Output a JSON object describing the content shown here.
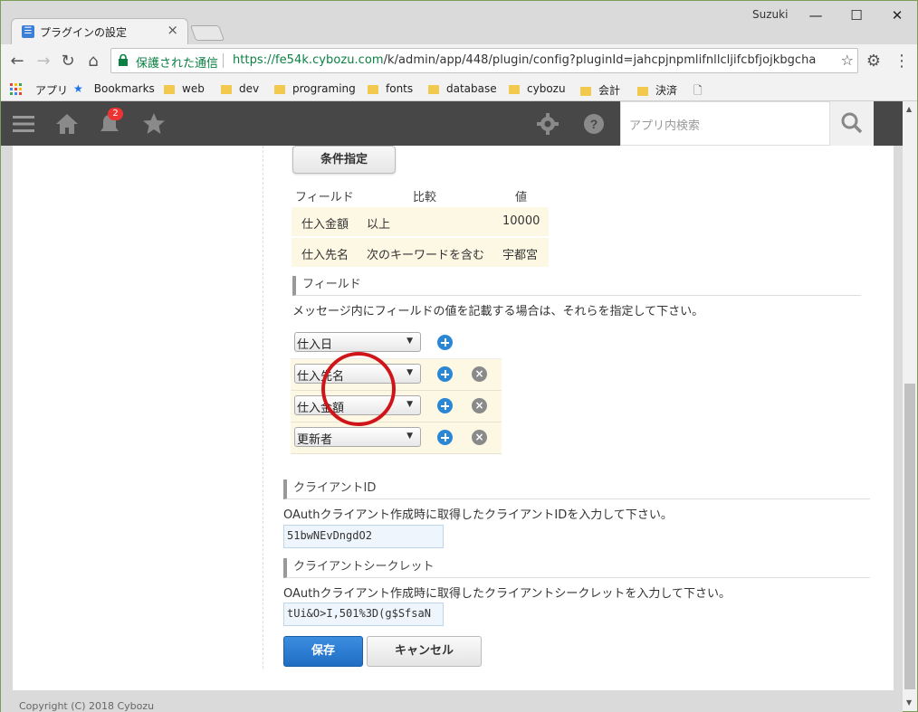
{
  "window": {
    "tab_title": "プラグインの設定",
    "tab_close": "×",
    "user": "Suzuki",
    "minimize": "—",
    "maximize": "☐",
    "close": "✕"
  },
  "toolbar": {
    "secure_label": "保護された通信",
    "url_origin": "https://fe54k.cybozu.com",
    "url_path": "/k/admin/app/448/plugin/config?pluginId=jahcpjnpmlifnllcljifcbfjojkbgcha"
  },
  "bookmarks": {
    "apps": "アプリ",
    "items": [
      "Bookmarks",
      "web",
      "dev",
      "programing",
      "fonts",
      "database",
      "cybozu",
      "会計",
      "決済"
    ]
  },
  "kintone": {
    "notification_count": "2",
    "search_placeholder": "アプリ内検索"
  },
  "conditions": {
    "button_label": "条件指定",
    "headers": [
      "フィールド",
      "比較",
      "値"
    ],
    "rows": [
      {
        "field": "仕入金額",
        "op": "以上",
        "value": "10000"
      },
      {
        "field": "仕入先名",
        "op": "次のキーワードを含む",
        "value": "宇都宮"
      }
    ]
  },
  "fields": {
    "title": "フィールド",
    "description": "メッセージ内にフィールドの値を記載する場合は、それらを指定して下さい。",
    "selected": [
      "仕入日",
      "仕入先名",
      "仕入金額",
      "更新者"
    ]
  },
  "client_id": {
    "title": "クライアントID",
    "description": "OAuthクライアント作成時に取得したクライアントIDを入力して下さい。",
    "value": "51bwNEvDngdO2"
  },
  "client_secret": {
    "title": "クライアントシークレット",
    "description": "OAuthクライアント作成時に取得したクライアントシークレットを入力して下さい。",
    "value": "tUi&O>I,501%3D(g$SfsaN"
  },
  "actions": {
    "save": "保存",
    "cancel": "キャンセル"
  },
  "footer": {
    "copyright": "Copyright (C) 2018 Cybozu"
  },
  "colors": {
    "highlight_circle": "#d0151a",
    "save_button": "#2a7bd4",
    "row_background": "#fdf8e4"
  }
}
